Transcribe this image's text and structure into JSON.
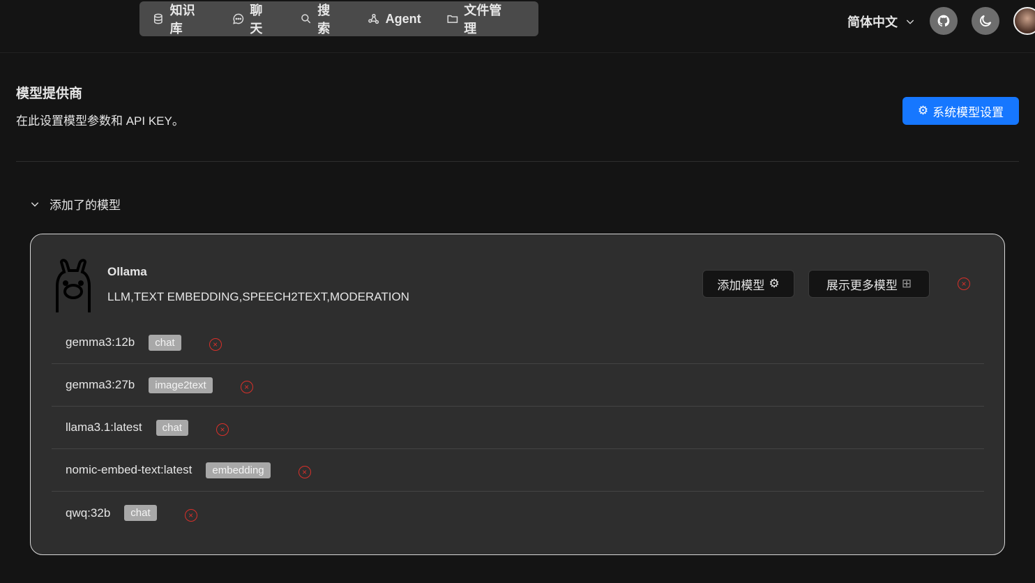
{
  "nav": {
    "items": [
      {
        "label": "知识库",
        "icon": "database-icon"
      },
      {
        "label": "聊天",
        "icon": "chat-icon"
      },
      {
        "label": "搜索",
        "icon": "search-icon"
      },
      {
        "label": "Agent",
        "icon": "graph-icon"
      },
      {
        "label": "文件管理",
        "icon": "folder-icon"
      }
    ]
  },
  "header": {
    "language": "简体中文"
  },
  "page": {
    "title": "模型提供商",
    "subtitle": "在此设置模型参数和 API KEY。",
    "system_settings_button": "系统模型设置",
    "accent": "#1677ff"
  },
  "section": {
    "label": "添加了的模型"
  },
  "provider": {
    "name": "Ollama",
    "capabilities": "LLM,TEXT EMBEDDING,SPEECH2TEXT,MODERATION",
    "add_model_button": "添加模型",
    "show_more_button": "展示更多模型",
    "models": [
      {
        "name": "gemma3:12b",
        "type": "chat"
      },
      {
        "name": "gemma3:27b",
        "type": "image2text"
      },
      {
        "name": "llama3.1:latest",
        "type": "chat"
      },
      {
        "name": "nomic-embed-text:latest",
        "type": "embedding"
      },
      {
        "name": "qwq:32b",
        "type": "chat"
      }
    ]
  }
}
